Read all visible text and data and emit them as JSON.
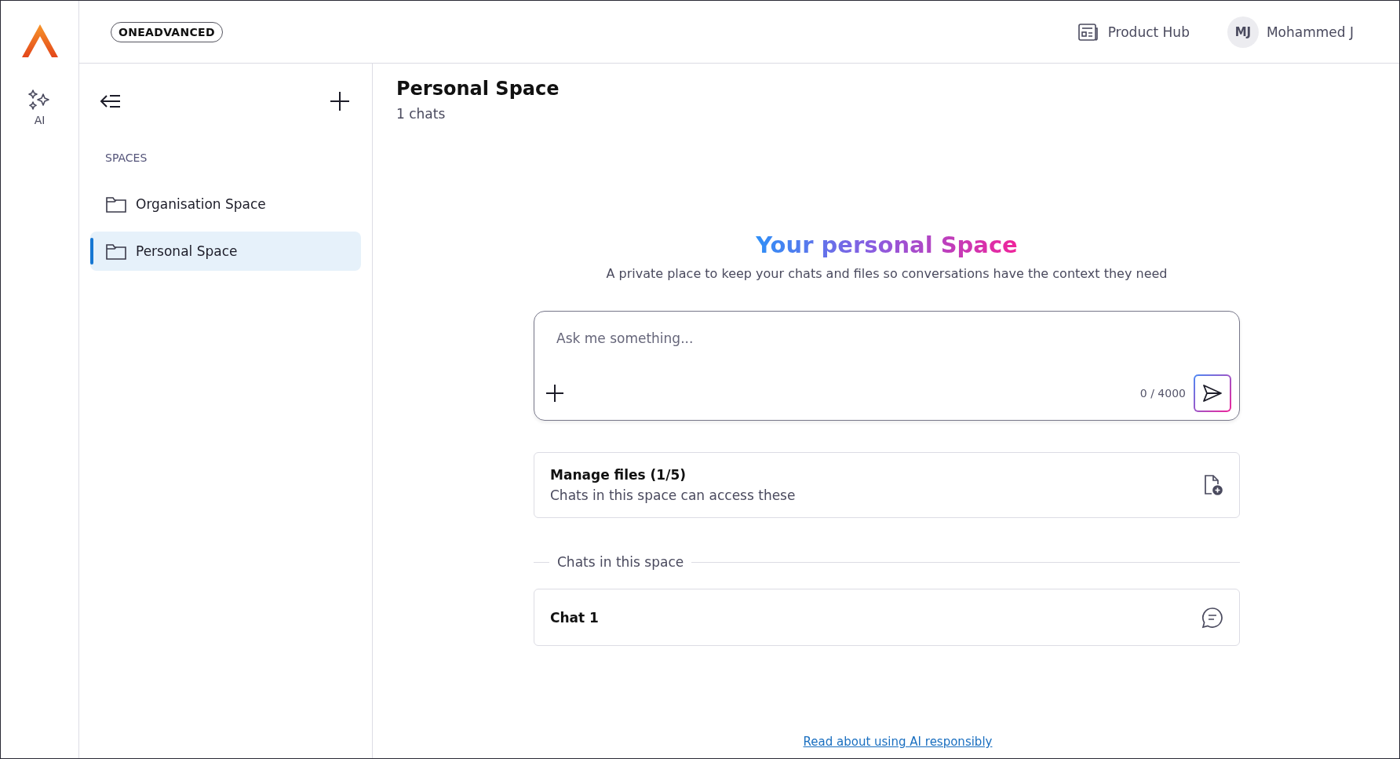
{
  "rail": {
    "items": [
      {
        "label": "AI"
      }
    ]
  },
  "header": {
    "brand": "ONEADVANCED",
    "product_hub": "Product Hub",
    "user": {
      "initials": "MJ",
      "name": "Mohammed J"
    }
  },
  "sidebar": {
    "section_title": "SPACES",
    "items": [
      {
        "label": "Organisation Space",
        "selected": false
      },
      {
        "label": "Personal Space",
        "selected": true
      }
    ]
  },
  "main": {
    "title": "Personal Space",
    "subtitle": "1 chats",
    "hero": {
      "title": "Your personal Space",
      "description": "A private place to keep your chats and files so conversations have the context they need"
    },
    "composer": {
      "placeholder": "Ask me something...",
      "counter": "0 / 4000"
    },
    "files_card": {
      "title": "Manage files (1/5)",
      "description": "Chats in this space can access these"
    },
    "chats_heading": "Chats in this space",
    "chats": [
      {
        "title": "Chat 1"
      }
    ],
    "footer_link": "Read about using AI responsibly"
  }
}
